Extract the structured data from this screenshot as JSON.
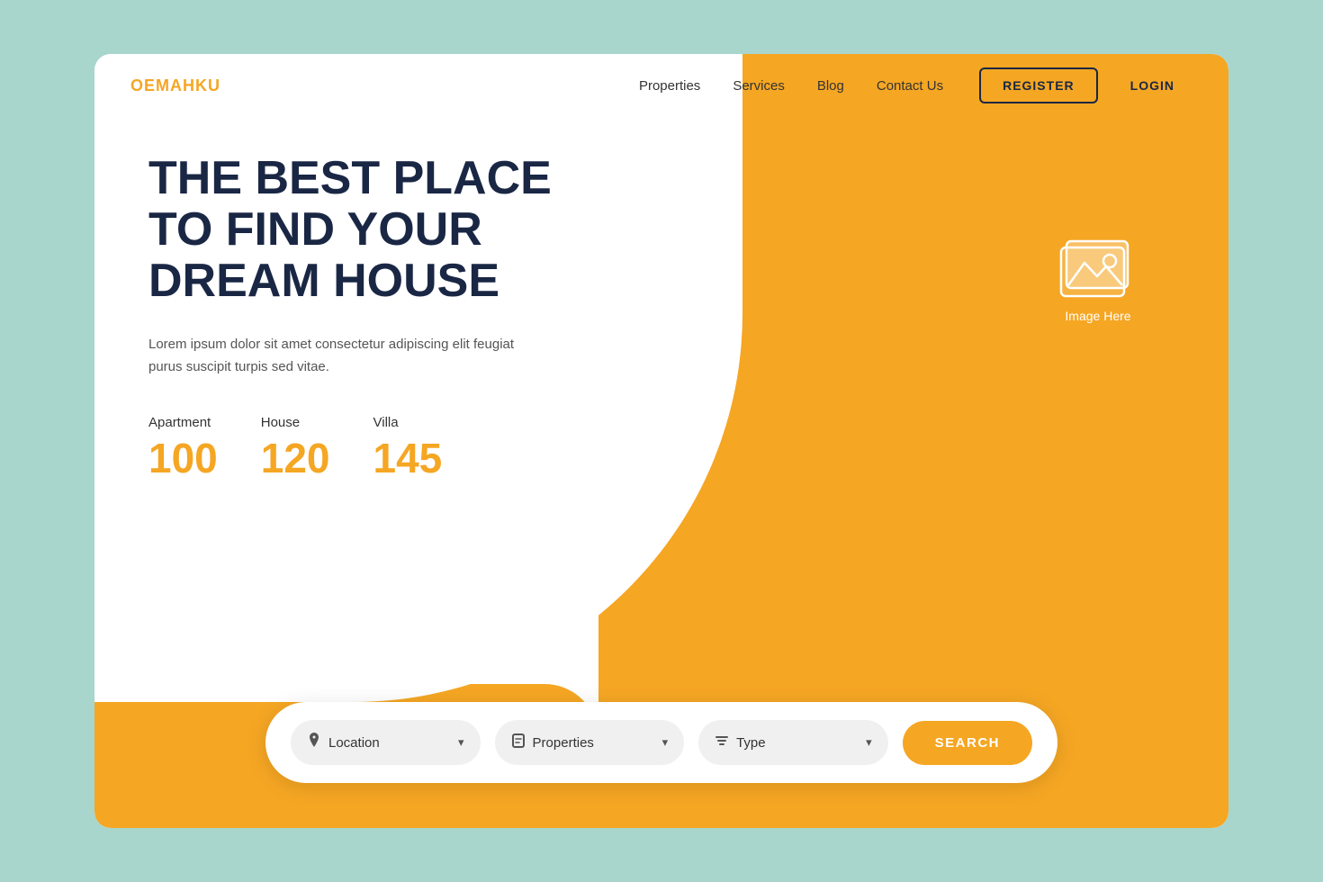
{
  "page": {
    "background_color": "#a8d5cc",
    "accent_color": "#F5A623",
    "dark_color": "#1a2744"
  },
  "navbar": {
    "logo": "OEMAHKU",
    "links": [
      {
        "label": "Properties",
        "id": "properties"
      },
      {
        "label": "Services",
        "id": "services"
      },
      {
        "label": "Blog",
        "id": "blog"
      },
      {
        "label": "Contact Us",
        "id": "contact"
      }
    ],
    "register_label": "REGISTER",
    "login_label": "LOGIN"
  },
  "hero": {
    "title_line1": "THE BEST PLACE",
    "title_line2": "TO FIND YOUR",
    "title_line3": "DREAM HOUSE",
    "description": "Lorem ipsum dolor sit amet consectetur adipiscing elit feugiat purus suscipit turpis sed vitae.",
    "image_label": "Image Here"
  },
  "stats": [
    {
      "label": "Apartment",
      "number": "100"
    },
    {
      "label": "House",
      "number": "120"
    },
    {
      "label": "Villa",
      "number": "145"
    }
  ],
  "search_bar": {
    "location_label": "Location",
    "properties_label": "Properties",
    "type_label": "Type",
    "search_button": "SEARCH"
  }
}
